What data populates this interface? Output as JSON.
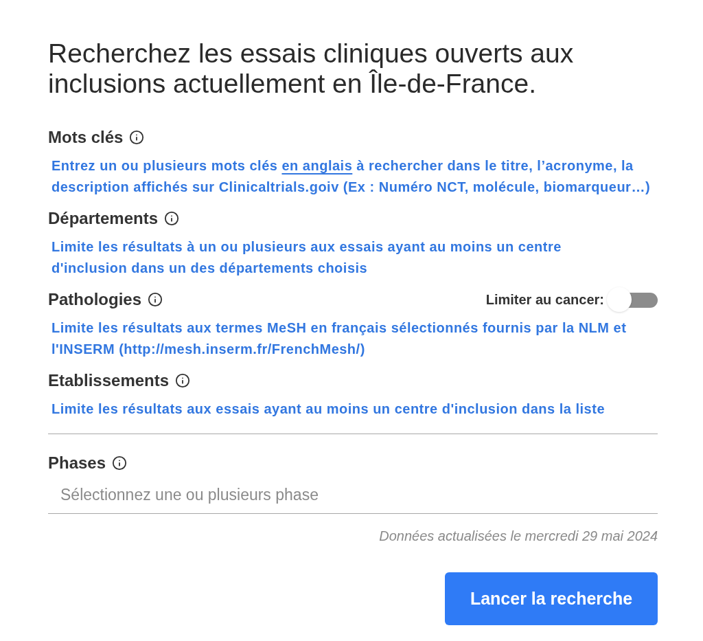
{
  "title": "Recherchez les essais cliniques ouverts aux inclusions actuellement en Île-de-France.",
  "filters": [
    {
      "kind": "hint",
      "label": "Mots clés",
      "hint": [
        {
          "text": "Entrez un ou plusieurs mots clés ",
          "underlined": false
        },
        {
          "text": "en anglais",
          "underlined": true
        },
        {
          "text": " à rechercher dans le titre, l’acronyme, la\ndescription affichés sur Clinicaltrials.goiv (Ex : Numéro NCT, molécule, biomarqueur…)",
          "underlined": false
        }
      ]
    },
    {
      "kind": "hint",
      "label": "Départements",
      "hint": [
        {
          "text": "Limite les résultats à un ou plusieurs aux essais ayant au moins un centre\nd'inclusion dans un des départements choisis",
          "underlined": false
        }
      ]
    },
    {
      "kind": "hint",
      "label": "Pathologies",
      "toggle": {
        "label": "Limiter au cancer:",
        "on": false
      },
      "hint": [
        {
          "text": "Limite les résultats aux termes MeSH en français sélectionnés fournis par la NLM et\nl'INSERM (http://mesh.inserm.fr/FrenchMesh/)",
          "underlined": false
        }
      ]
    },
    {
      "kind": "hint",
      "label": "Etablissements",
      "hint": [
        {
          "text": "Limite les résultats aux essais ayant au moins un centre d'inclusion dans la liste",
          "underlined": false
        }
      ]
    },
    {
      "kind": "select",
      "label": "Phases",
      "placeholder": "Sélectionnez une ou plusieurs phase"
    }
  ],
  "updated": "Données actualisées le mercredi 29 mai 2024",
  "submit": "Lancer la recherche"
}
